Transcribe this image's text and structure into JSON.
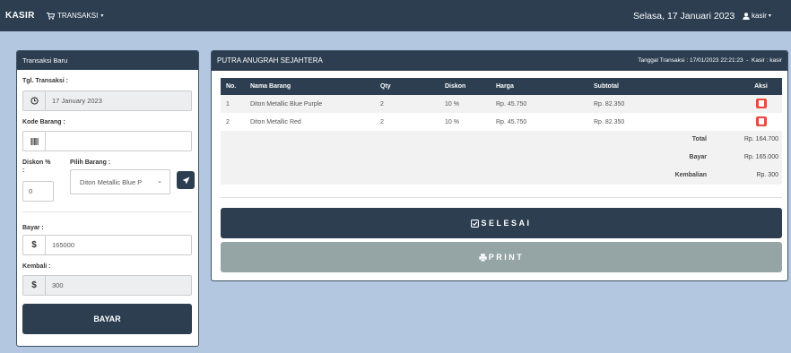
{
  "navbar": {
    "brand": "KASIR",
    "menu_icon": "cart-icon",
    "menu_label": "TRANSAKSI",
    "date": "Selasa, 17 Januari 2023",
    "user": "kasir"
  },
  "left_panel": {
    "title": "Transaksi Baru",
    "tgl_label": "Tgl. Transaksi :",
    "tgl_value": "17 January 2023",
    "kode_label": "Kode Barang :",
    "kode_value": "",
    "diskon_label": "Diskon %",
    "diskon_colon": ":",
    "diskon_value": "0",
    "pilih_label": "Pilih Barang :",
    "pilih_value": "Diton Metallic Blue P",
    "bayar_label": "Bayar :",
    "bayar_value": "165000",
    "kembali_label": "Kembali :",
    "kembali_value": "300",
    "currency_symbol": "$",
    "bayar_button": "BAYAR"
  },
  "right_panel": {
    "store_name": "PUTRA ANUGRAH SEJAHTERA",
    "meta": "Tanggal Transaksi : 17/01/2023 22:21:23  -  Kasir : kasir",
    "columns": [
      "No.",
      "Nama Barang",
      "Qty",
      "Diskon",
      "Harga",
      "Subtotal",
      "Aksi"
    ],
    "rows": [
      {
        "no": "1",
        "nama": "Diton Metallic Blue Purple",
        "qty": "2",
        "diskon": "10 %",
        "harga": "Rp. 45.750",
        "subtotal": "Rp. 82.350"
      },
      {
        "no": "2",
        "nama": "Diton Metallic Red",
        "qty": "2",
        "diskon": "10 %",
        "harga": "Rp. 45.750",
        "subtotal": "Rp. 82.350"
      }
    ],
    "total_label": "Total",
    "total_value": "Rp. 164.700",
    "bayar_label": "Bayar",
    "bayar_value": "Rp. 165.000",
    "kembalian_label": "Kembalian",
    "kembalian_value": "Rp. 300",
    "selesai_button": "SELESAI",
    "print_button": "PRINT"
  },
  "colors": {
    "navbar": "#2c3e50",
    "background": "#b3c7e0",
    "delete": "#e74c3c",
    "print": "#95a5a6"
  }
}
